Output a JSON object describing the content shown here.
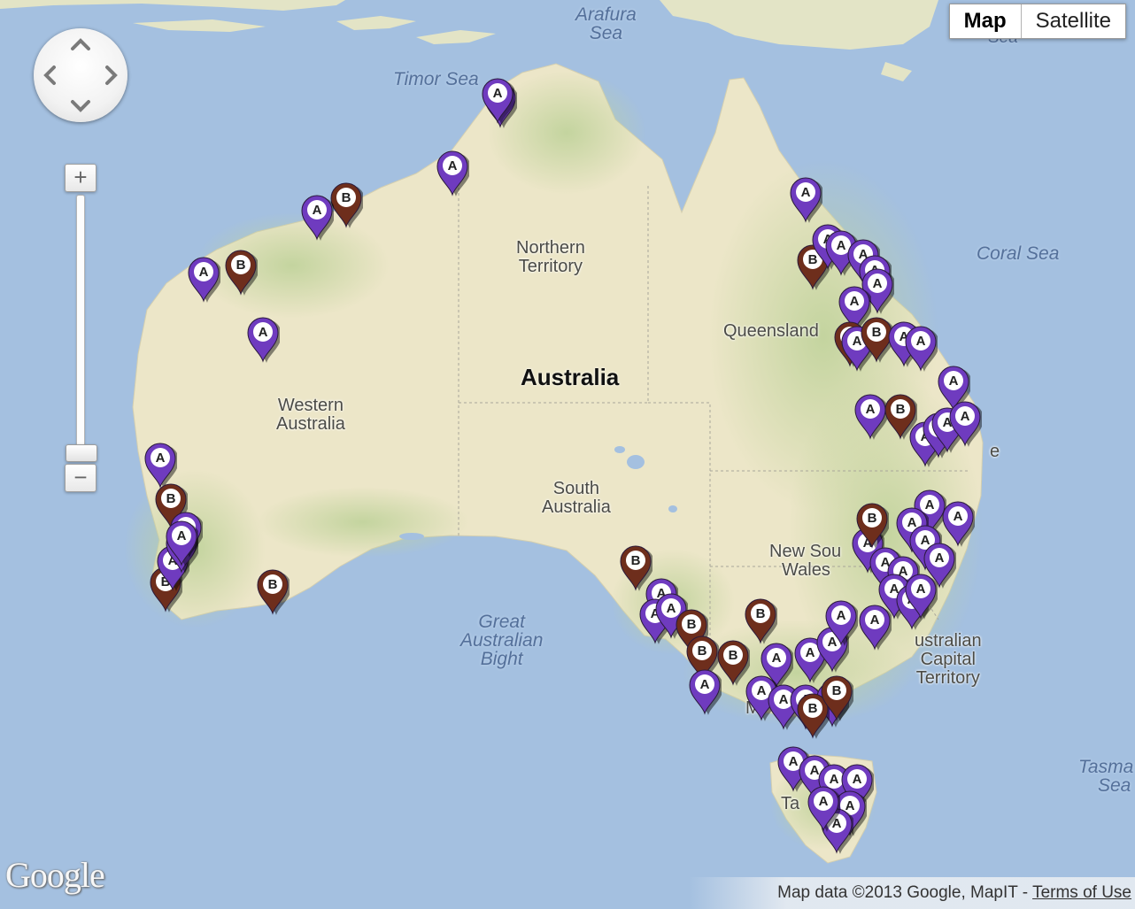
{
  "map_type": {
    "options": [
      "Map",
      "Satellite"
    ],
    "selected": "Map"
  },
  "controls": {
    "zoom_in": "+",
    "zoom_out": "−",
    "pan_icon": "pan-arrows-icon"
  },
  "logo": "Google",
  "attribution": {
    "text": "Map data ©2013 Google, MapIT - ",
    "terms": "Terms of Use"
  },
  "labels": {
    "arafura": [
      "Arafura",
      "Sea"
    ],
    "timor": "Timor Sea",
    "coral": "Coral Sea",
    "nt": [
      "Northern",
      "Territory"
    ],
    "qld": "Queensland",
    "australia": "Australia",
    "wa": [
      "Western",
      "Australia"
    ],
    "sa": [
      "South",
      "Australia"
    ],
    "nsw": [
      "New Sou",
      "Wales"
    ],
    "act": [
      "ustralian",
      "Capital",
      "Territory"
    ],
    "gab": [
      "Great",
      "Australian",
      "Bight"
    ],
    "tasman": [
      "Tasma",
      "Sea"
    ],
    "bris_frag": "e",
    "melb_frag": "M",
    "tas_frag": "Ta",
    "top_frag": "Sea"
  },
  "marker_types": [
    {
      "letter": "A",
      "color": "#6f3bbf",
      "icon": "map-pin-a-icon"
    },
    {
      "letter": "B",
      "color": "#6e2e1c",
      "icon": "map-pin-b-icon"
    }
  ],
  "colors": {
    "water": "#a4c0e0",
    "land": "#ece6c8",
    "vegetation": "#c8d8a4",
    "pin_a": "#6f3bbf",
    "pin_b": "#6e2e1c"
  }
}
